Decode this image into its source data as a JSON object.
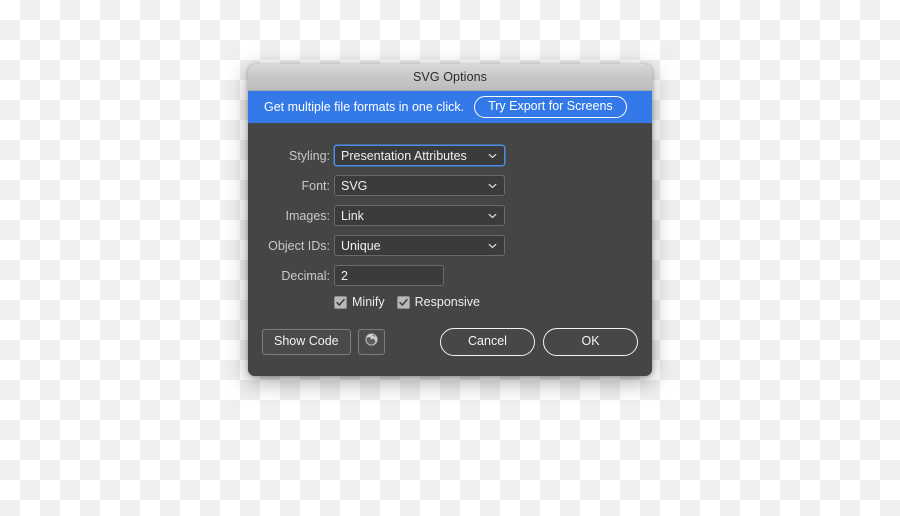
{
  "dialog": {
    "title": "SVG Options",
    "banner": {
      "text": "Get multiple file formats in one click.",
      "button_label": "Try Export for Screens",
      "background_color": "#3379e8"
    },
    "fields": [
      {
        "label": "Styling:",
        "control": "select",
        "value": "Presentation Attributes",
        "focused": true,
        "name": "styling"
      },
      {
        "label": "Font:",
        "control": "select",
        "value": "SVG",
        "focused": false,
        "name": "font"
      },
      {
        "label": "Images:",
        "control": "select",
        "value": "Link",
        "focused": false,
        "name": "images"
      },
      {
        "label": "Object IDs:",
        "control": "select",
        "value": "Unique",
        "focused": false,
        "name": "object-ids"
      },
      {
        "label": "Decimal:",
        "control": "text",
        "value": "2",
        "placeholder": "",
        "name": "decimal"
      }
    ],
    "checkboxes": [
      {
        "label": "Minify",
        "checked": true,
        "name": "minify"
      },
      {
        "label": "Responsive",
        "checked": true,
        "name": "responsive"
      }
    ],
    "footer": {
      "show_code_label": "Show Code",
      "globe_icon": "globe-icon",
      "cancel_label": "Cancel",
      "ok_label": "OK"
    }
  }
}
